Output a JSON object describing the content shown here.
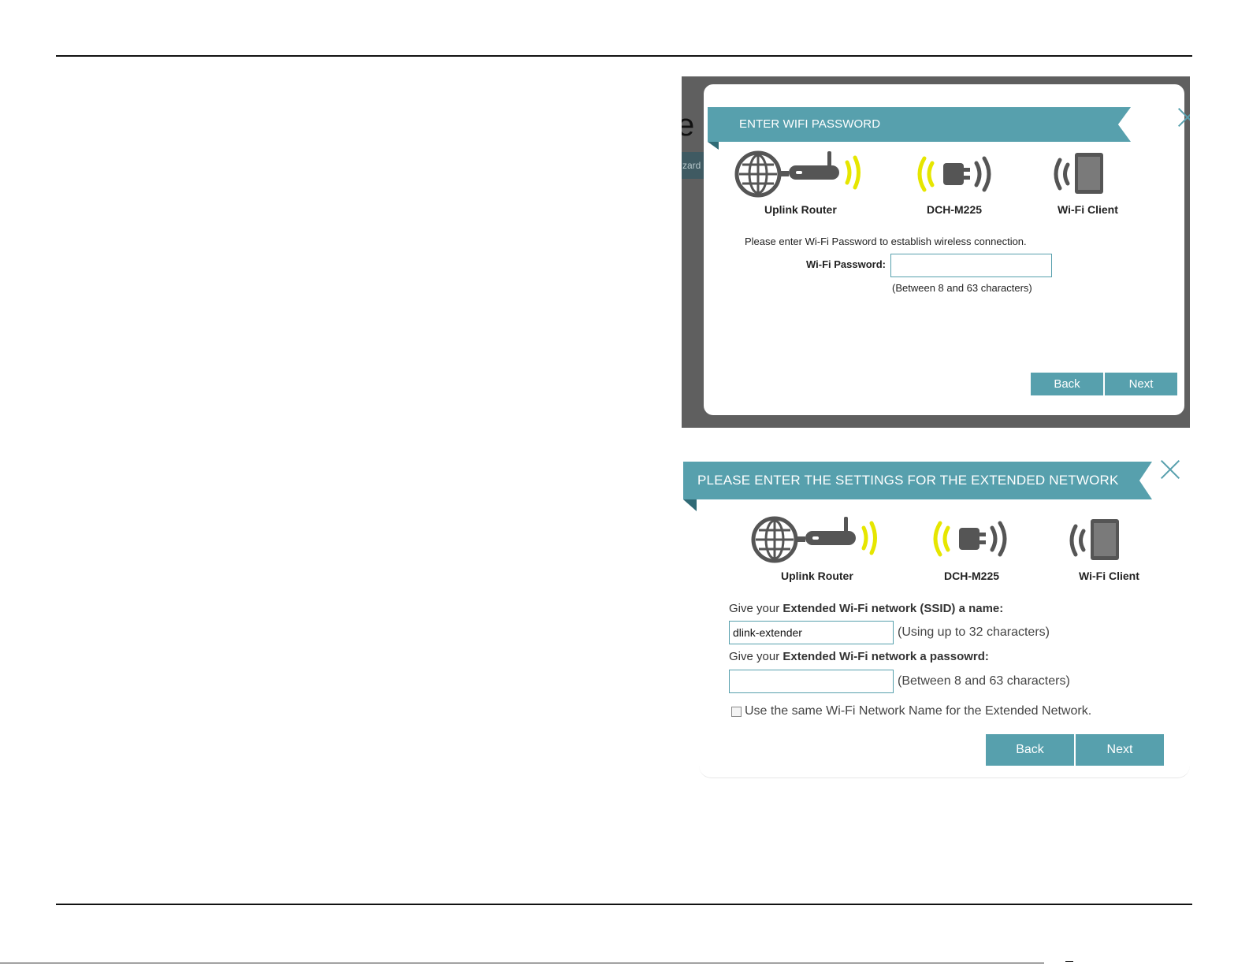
{
  "dialog1": {
    "title": "ENTER WIFI PASSWORD",
    "devices": [
      "Uplink Router",
      "DCH-M225",
      "Wi-Fi Client"
    ],
    "instruction": "Please enter Wi-Fi Password to establish wireless connection.",
    "password_label": "Wi-Fi Password:",
    "password_value": "",
    "password_hint": "(Between 8 and 63 characters)",
    "back_label": "Back",
    "next_label": "Next"
  },
  "dialog2": {
    "title": "PLEASE ENTER THE SETTINGS FOR THE EXTENDED NETWORK",
    "devices": [
      "Uplink Router",
      "DCH-M225",
      "Wi-Fi Client"
    ],
    "ssid_prompt_prefix": "Give your ",
    "ssid_prompt_bold": "Extended Wi-Fi network (SSID) a name:",
    "ssid_value": "dlink-extender",
    "ssid_hint": "(Using up to 32 characters)",
    "password_prompt_prefix": "Give your ",
    "password_prompt_bold": "Extended Wi-Fi network a passowrd:",
    "password_value": "",
    "password_hint": "(Between 8 and 63 characters)",
    "same_name_label": "Use the same Wi-Fi Network Name for the Extended Network.",
    "back_label": "Back",
    "next_label": "Next"
  },
  "colors": {
    "accent": "#57a0ad",
    "accent_dark": "#2f6a75",
    "signal_yellow": "#e6e600",
    "device_gray": "#555555"
  },
  "icons": {
    "router": "globe-router-icon",
    "extender": "extender-plug-icon",
    "client": "tablet-icon",
    "close": "close-icon"
  }
}
